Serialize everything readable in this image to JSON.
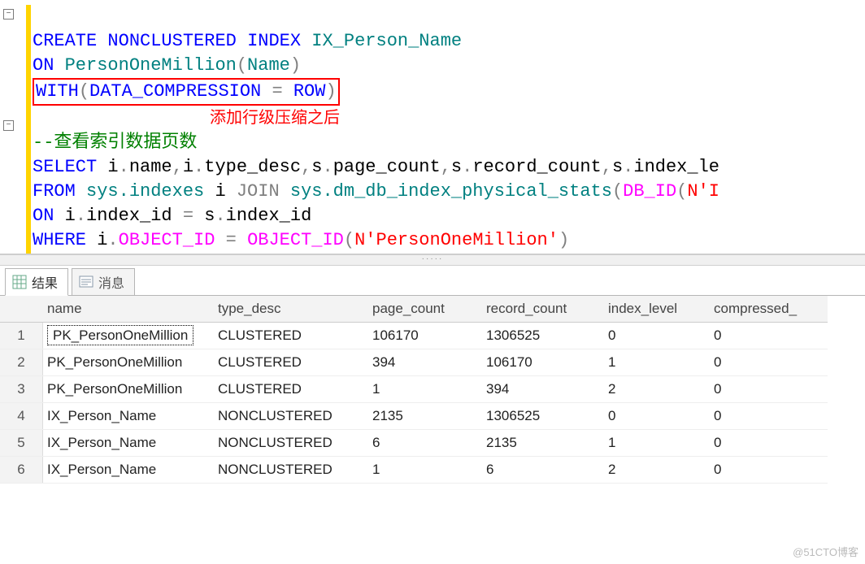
{
  "sql": {
    "l1_a": "CREATE",
    "l1_b": " NONCLUSTERED ",
    "l1_c": "INDEX",
    "l1_d": " IX_Person_Name",
    "l2_a": "ON",
    "l2_b": " PersonOneMillion",
    "l2_c": "(",
    "l2_d": "Name",
    "l2_e": ")",
    "l3_a": "WITH",
    "l3_b": "(",
    "l3_c": "DATA_COMPRESSION ",
    "l3_d": "=",
    "l3_e": " ROW",
    "l3_f": ")",
    "annot": "添加行级压缩之后",
    "cmt": "--查看索引数据页数",
    "l5_a": "SELECT",
    "l5_b": " i",
    "l5_c": ".",
    "l5_d": "name",
    "l5_e": ",",
    "l5_f": "i",
    "l5_g": ".",
    "l5_h": "type_desc",
    "l5_i": ",",
    "l5_j": "s",
    "l5_k": ".",
    "l5_l": "page_count",
    "l5_m": ",",
    "l5_n": "s",
    "l5_o": ".",
    "l5_p": "record_count",
    "l5_q": ",",
    "l5_r": "s",
    "l5_s": ".",
    "l5_t": "index_le",
    "l6_a": "FROM",
    "l6_b": " sys.indexes",
    "l6_c": " i ",
    "l6_d": "JOIN",
    "l6_e": " sys.dm_db_index_physical_stats",
    "l6_f": "(",
    "l6_g": "DB_ID",
    "l6_h": "(",
    "l6_i": "N'I",
    "l7_a": "ON",
    "l7_b": " i",
    "l7_c": ".",
    "l7_d": "index_id ",
    "l7_e": "=",
    "l7_f": " s",
    "l7_g": ".",
    "l7_h": "index_id",
    "l8_a": "WHERE",
    "l8_b": " i",
    "l8_c": ".",
    "l8_d": "OBJECT_ID",
    "l8_e": " = ",
    "l8_f": "OBJECT_ID",
    "l8_g": "(",
    "l8_h": "N'PersonOneMillion'",
    "l8_i": ")"
  },
  "tabs": {
    "results": "结果",
    "messages": "消息"
  },
  "grid": {
    "headers": [
      "name",
      "type_desc",
      "page_count",
      "record_count",
      "index_level",
      "compressed_"
    ],
    "rows": [
      {
        "n": "1",
        "c": [
          "PK_PersonOneMillion",
          "CLUSTERED",
          "106170",
          "1306525",
          "0",
          "0"
        ],
        "sel": true
      },
      {
        "n": "2",
        "c": [
          "PK_PersonOneMillion",
          "CLUSTERED",
          "394",
          "106170",
          "1",
          "0"
        ]
      },
      {
        "n": "3",
        "c": [
          "PK_PersonOneMillion",
          "CLUSTERED",
          "1",
          "394",
          "2",
          "0"
        ]
      },
      {
        "n": "4",
        "c": [
          "IX_Person_Name",
          "NONCLUSTERED",
          "2135",
          "1306525",
          "0",
          "0"
        ]
      },
      {
        "n": "5",
        "c": [
          "IX_Person_Name",
          "NONCLUSTERED",
          "6",
          "2135",
          "1",
          "0"
        ]
      },
      {
        "n": "6",
        "c": [
          "IX_Person_Name",
          "NONCLUSTERED",
          "1",
          "6",
          "2",
          "0"
        ]
      }
    ]
  },
  "watermark": "@51CTO博客"
}
